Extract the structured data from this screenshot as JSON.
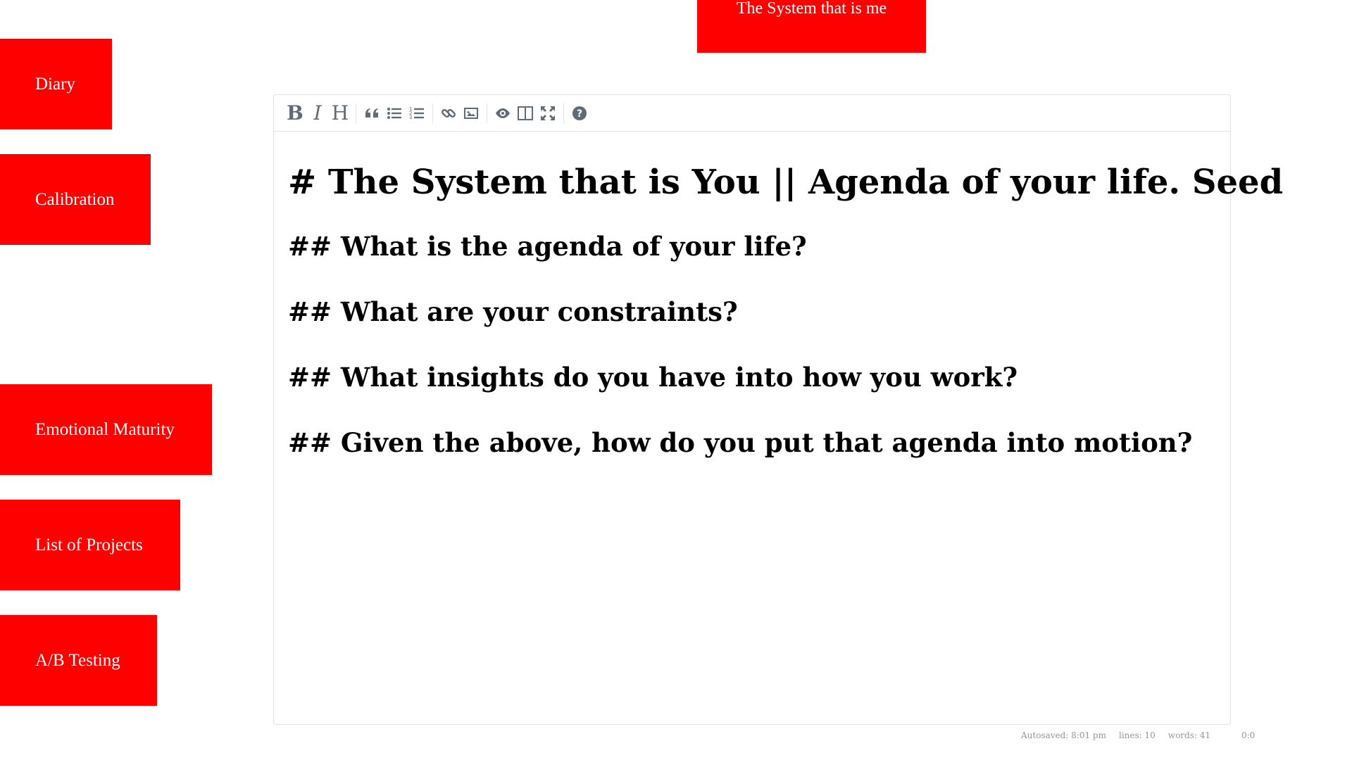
{
  "header": {
    "title": "The System that is me"
  },
  "nav": {
    "diary": "Diary",
    "calibration": "Calibration",
    "emotional_maturity": "Emotional Maturity",
    "list_of_projects": "List of Projects",
    "ab_testing": "A/B Testing"
  },
  "toolbar": {
    "buttons": [
      {
        "name": "bold",
        "icon": "bold-icon",
        "glyph": "B"
      },
      {
        "name": "italic",
        "icon": "italic-icon",
        "glyph": "I"
      },
      {
        "name": "heading",
        "icon": "heading-icon",
        "glyph": "H"
      },
      {
        "name": "quote",
        "icon": "quote-icon"
      },
      {
        "name": "unordered-list",
        "icon": "unordered-list-icon"
      },
      {
        "name": "ordered-list",
        "icon": "ordered-list-icon"
      },
      {
        "name": "link",
        "icon": "link-icon"
      },
      {
        "name": "image",
        "icon": "image-icon"
      },
      {
        "name": "preview",
        "icon": "eye-icon"
      },
      {
        "name": "side-by-side",
        "icon": "columns-icon"
      },
      {
        "name": "fullscreen",
        "icon": "fullscreen-icon"
      },
      {
        "name": "guide",
        "icon": "question-icon"
      }
    ],
    "colors": {
      "icon": "#5f6b76",
      "border": "#dfe3e8"
    }
  },
  "editor": {
    "h1": "# The System that is You || Agenda of your life. Seed",
    "h2_1": "## What is the agenda of your life?",
    "h2_2": "## What are your constraints?",
    "h2_3": "## What insights do you have into how you work?",
    "h2_4": "## Given the above, how do you put that agenda into motion?"
  },
  "statusbar": {
    "autosave": "Autosaved: 8:01 pm",
    "lines": "lines: 10",
    "words": "words: 41",
    "cursor": "0:0"
  },
  "colors": {
    "accent": "#ff0000",
    "text_on_accent": "#ffffff"
  }
}
